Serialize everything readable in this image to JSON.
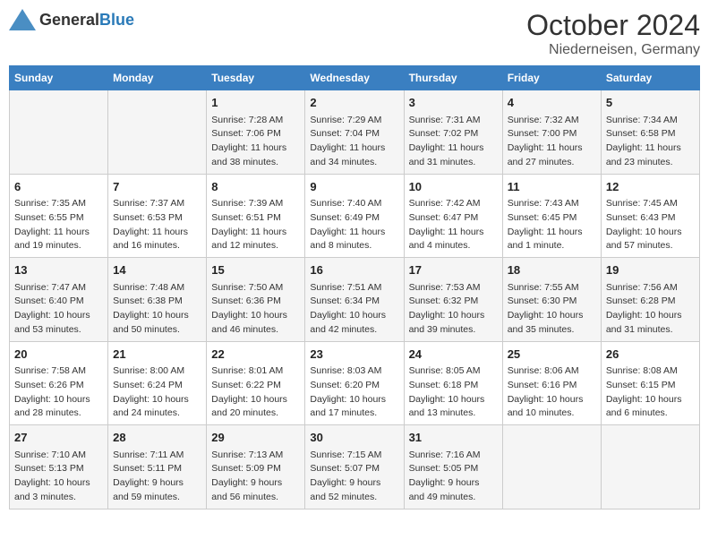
{
  "logo": {
    "text_general": "General",
    "text_blue": "Blue"
  },
  "title": "October 2024",
  "location": "Niederneisen, Germany",
  "days_of_week": [
    "Sunday",
    "Monday",
    "Tuesday",
    "Wednesday",
    "Thursday",
    "Friday",
    "Saturday"
  ],
  "weeks": [
    [
      {
        "num": "",
        "sunrise": "",
        "sunset": "",
        "daylight": ""
      },
      {
        "num": "",
        "sunrise": "",
        "sunset": "",
        "daylight": ""
      },
      {
        "num": "1",
        "sunrise": "Sunrise: 7:28 AM",
        "sunset": "Sunset: 7:06 PM",
        "daylight": "Daylight: 11 hours and 38 minutes."
      },
      {
        "num": "2",
        "sunrise": "Sunrise: 7:29 AM",
        "sunset": "Sunset: 7:04 PM",
        "daylight": "Daylight: 11 hours and 34 minutes."
      },
      {
        "num": "3",
        "sunrise": "Sunrise: 7:31 AM",
        "sunset": "Sunset: 7:02 PM",
        "daylight": "Daylight: 11 hours and 31 minutes."
      },
      {
        "num": "4",
        "sunrise": "Sunrise: 7:32 AM",
        "sunset": "Sunset: 7:00 PM",
        "daylight": "Daylight: 11 hours and 27 minutes."
      },
      {
        "num": "5",
        "sunrise": "Sunrise: 7:34 AM",
        "sunset": "Sunset: 6:58 PM",
        "daylight": "Daylight: 11 hours and 23 minutes."
      }
    ],
    [
      {
        "num": "6",
        "sunrise": "Sunrise: 7:35 AM",
        "sunset": "Sunset: 6:55 PM",
        "daylight": "Daylight: 11 hours and 19 minutes."
      },
      {
        "num": "7",
        "sunrise": "Sunrise: 7:37 AM",
        "sunset": "Sunset: 6:53 PM",
        "daylight": "Daylight: 11 hours and 16 minutes."
      },
      {
        "num": "8",
        "sunrise": "Sunrise: 7:39 AM",
        "sunset": "Sunset: 6:51 PM",
        "daylight": "Daylight: 11 hours and 12 minutes."
      },
      {
        "num": "9",
        "sunrise": "Sunrise: 7:40 AM",
        "sunset": "Sunset: 6:49 PM",
        "daylight": "Daylight: 11 hours and 8 minutes."
      },
      {
        "num": "10",
        "sunrise": "Sunrise: 7:42 AM",
        "sunset": "Sunset: 6:47 PM",
        "daylight": "Daylight: 11 hours and 4 minutes."
      },
      {
        "num": "11",
        "sunrise": "Sunrise: 7:43 AM",
        "sunset": "Sunset: 6:45 PM",
        "daylight": "Daylight: 11 hours and 1 minute."
      },
      {
        "num": "12",
        "sunrise": "Sunrise: 7:45 AM",
        "sunset": "Sunset: 6:43 PM",
        "daylight": "Daylight: 10 hours and 57 minutes."
      }
    ],
    [
      {
        "num": "13",
        "sunrise": "Sunrise: 7:47 AM",
        "sunset": "Sunset: 6:40 PM",
        "daylight": "Daylight: 10 hours and 53 minutes."
      },
      {
        "num": "14",
        "sunrise": "Sunrise: 7:48 AM",
        "sunset": "Sunset: 6:38 PM",
        "daylight": "Daylight: 10 hours and 50 minutes."
      },
      {
        "num": "15",
        "sunrise": "Sunrise: 7:50 AM",
        "sunset": "Sunset: 6:36 PM",
        "daylight": "Daylight: 10 hours and 46 minutes."
      },
      {
        "num": "16",
        "sunrise": "Sunrise: 7:51 AM",
        "sunset": "Sunset: 6:34 PM",
        "daylight": "Daylight: 10 hours and 42 minutes."
      },
      {
        "num": "17",
        "sunrise": "Sunrise: 7:53 AM",
        "sunset": "Sunset: 6:32 PM",
        "daylight": "Daylight: 10 hours and 39 minutes."
      },
      {
        "num": "18",
        "sunrise": "Sunrise: 7:55 AM",
        "sunset": "Sunset: 6:30 PM",
        "daylight": "Daylight: 10 hours and 35 minutes."
      },
      {
        "num": "19",
        "sunrise": "Sunrise: 7:56 AM",
        "sunset": "Sunset: 6:28 PM",
        "daylight": "Daylight: 10 hours and 31 minutes."
      }
    ],
    [
      {
        "num": "20",
        "sunrise": "Sunrise: 7:58 AM",
        "sunset": "Sunset: 6:26 PM",
        "daylight": "Daylight: 10 hours and 28 minutes."
      },
      {
        "num": "21",
        "sunrise": "Sunrise: 8:00 AM",
        "sunset": "Sunset: 6:24 PM",
        "daylight": "Daylight: 10 hours and 24 minutes."
      },
      {
        "num": "22",
        "sunrise": "Sunrise: 8:01 AM",
        "sunset": "Sunset: 6:22 PM",
        "daylight": "Daylight: 10 hours and 20 minutes."
      },
      {
        "num": "23",
        "sunrise": "Sunrise: 8:03 AM",
        "sunset": "Sunset: 6:20 PM",
        "daylight": "Daylight: 10 hours and 17 minutes."
      },
      {
        "num": "24",
        "sunrise": "Sunrise: 8:05 AM",
        "sunset": "Sunset: 6:18 PM",
        "daylight": "Daylight: 10 hours and 13 minutes."
      },
      {
        "num": "25",
        "sunrise": "Sunrise: 8:06 AM",
        "sunset": "Sunset: 6:16 PM",
        "daylight": "Daylight: 10 hours and 10 minutes."
      },
      {
        "num": "26",
        "sunrise": "Sunrise: 8:08 AM",
        "sunset": "Sunset: 6:15 PM",
        "daylight": "Daylight: 10 hours and 6 minutes."
      }
    ],
    [
      {
        "num": "27",
        "sunrise": "Sunrise: 7:10 AM",
        "sunset": "Sunset: 5:13 PM",
        "daylight": "Daylight: 10 hours and 3 minutes."
      },
      {
        "num": "28",
        "sunrise": "Sunrise: 7:11 AM",
        "sunset": "Sunset: 5:11 PM",
        "daylight": "Daylight: 9 hours and 59 minutes."
      },
      {
        "num": "29",
        "sunrise": "Sunrise: 7:13 AM",
        "sunset": "Sunset: 5:09 PM",
        "daylight": "Daylight: 9 hours and 56 minutes."
      },
      {
        "num": "30",
        "sunrise": "Sunrise: 7:15 AM",
        "sunset": "Sunset: 5:07 PM",
        "daylight": "Daylight: 9 hours and 52 minutes."
      },
      {
        "num": "31",
        "sunrise": "Sunrise: 7:16 AM",
        "sunset": "Sunset: 5:05 PM",
        "daylight": "Daylight: 9 hours and 49 minutes."
      },
      {
        "num": "",
        "sunrise": "",
        "sunset": "",
        "daylight": ""
      },
      {
        "num": "",
        "sunrise": "",
        "sunset": "",
        "daylight": ""
      }
    ]
  ]
}
